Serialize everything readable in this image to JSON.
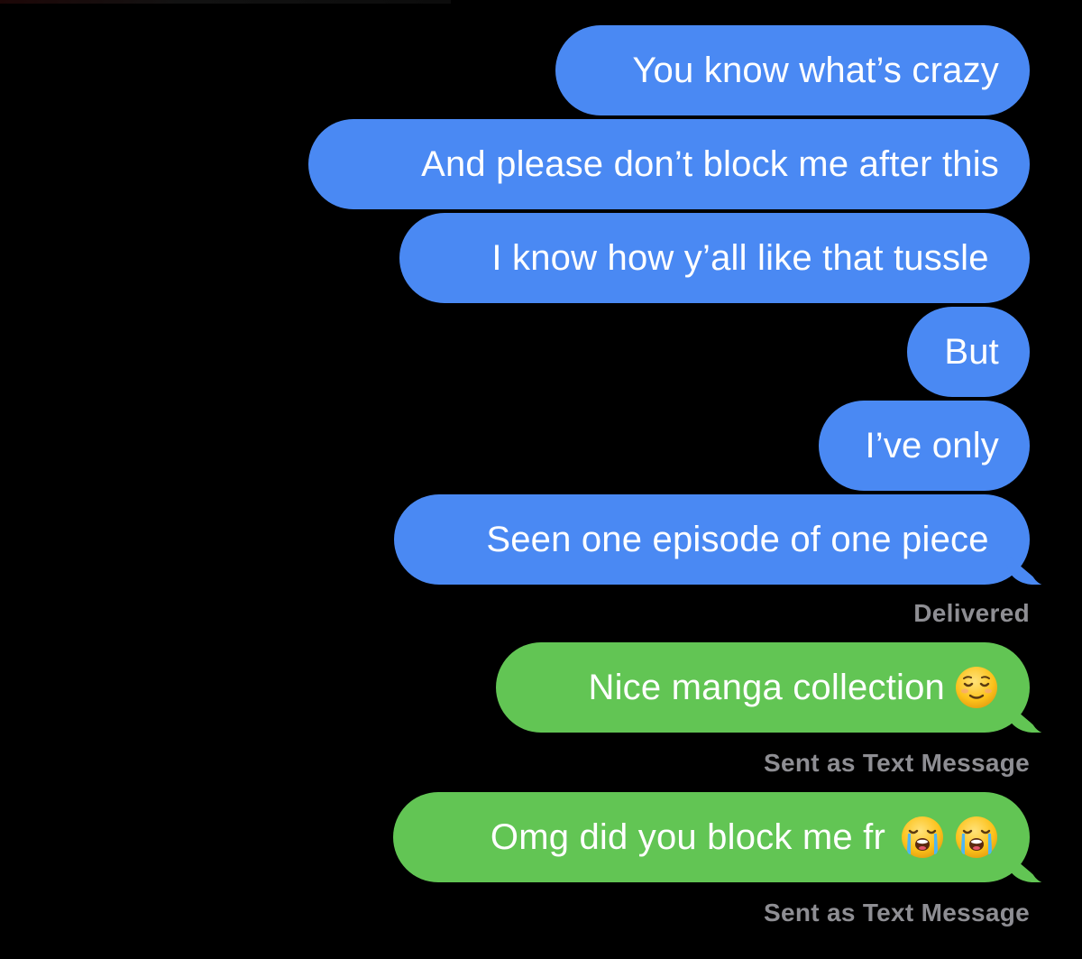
{
  "conversation": {
    "messages": [
      {
        "text": "You know what’s crazy",
        "type": "imessage"
      },
      {
        "text": "And please don’t block me after this",
        "type": "imessage"
      },
      {
        "text": "I know how y’all like that tussle ",
        "type": "imessage"
      },
      {
        "text": "But",
        "type": "imessage"
      },
      {
        "text": "I’ve only",
        "type": "imessage"
      },
      {
        "text": "Seen one episode of one piece ",
        "type": "imessage"
      },
      {
        "text": "Nice manga collection",
        "type": "sms",
        "emoji": [
          "relieved-face-icon"
        ]
      },
      {
        "text": "Omg did you block me fr",
        "type": "sms",
        "emoji": [
          "loudly-crying-face-icon",
          "loudly-crying-face-icon"
        ]
      }
    ],
    "statuses": {
      "delivered": "Delivered",
      "sent_as_text_1": "Sent as Text Message",
      "sent_as_text_2": "Sent as Text Message"
    }
  },
  "colors": {
    "background": "#000000",
    "imessage_bubble": "#4a89f3",
    "sms_bubble": "#62c554",
    "status_text": "#8e8e93",
    "bubble_text": "#ffffff"
  }
}
